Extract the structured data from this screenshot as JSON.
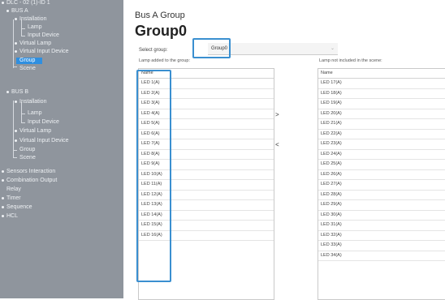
{
  "sidebar": {
    "items": [
      {
        "label": "DLC - 02 (1)-ID 1",
        "selected": false
      },
      {
        "label": "BUS A",
        "selected": false
      },
      {
        "label": "Installation",
        "selected": false
      },
      {
        "label": "Lamp",
        "selected": false
      },
      {
        "label": "Input Device",
        "selected": false
      },
      {
        "label": "Virtual Lamp",
        "selected": false
      },
      {
        "label": "Virtual Input Device",
        "selected": false
      },
      {
        "label": "Group",
        "selected": true
      },
      {
        "label": "Scene",
        "selected": false
      },
      {
        "label": "BUS B",
        "selected": false
      },
      {
        "label": "Installation",
        "selected": false
      },
      {
        "label": "Lamp",
        "selected": false
      },
      {
        "label": "Input Device",
        "selected": false
      },
      {
        "label": "Virtual Lamp",
        "selected": false
      },
      {
        "label": "Virtual Input Device",
        "selected": false
      },
      {
        "label": "Group",
        "selected": false
      },
      {
        "label": "Scene",
        "selected": false
      },
      {
        "label": "Sensors Interaction",
        "selected": false
      },
      {
        "label": "Combination Output",
        "selected": false
      },
      {
        "label": "Relay",
        "selected": false
      },
      {
        "label": "Timer",
        "selected": false
      },
      {
        "label": "Sequence",
        "selected": false
      },
      {
        "label": "HCL",
        "selected": false
      }
    ]
  },
  "main": {
    "subtitle": "Bus A Group",
    "title": "Group0",
    "select_label": "Select group:",
    "select_value": "Group0",
    "select_arrow": "⌄",
    "left_list_label": "Lamp added to the group:",
    "right_list_label": "Lamp not included in the scene:",
    "add_button": ">",
    "remove_button": "<",
    "left_list": {
      "header": "Name",
      "rows": [
        "LED 1(A)",
        "LED 2(A)",
        "LED 3(A)",
        "LED 4(A)",
        "LED 5(A)",
        "LED 6(A)",
        "LED 7(A)",
        "LED 8(A)",
        "LED 9(A)",
        "LED 10(A)",
        "LED 11(A)",
        "LED 12(A)",
        "LED 13(A)",
        "LED 14(A)",
        "LED 15(A)",
        "LED 16(A)"
      ]
    },
    "right_list": {
      "header": "Name",
      "rows": [
        "LED 17(A)",
        "LED 18(A)",
        "LED 19(A)",
        "LED 20(A)",
        "LED 21(A)",
        "LED 22(A)",
        "LED 23(A)",
        "LED 24(A)",
        "LED 25(A)",
        "LED 26(A)",
        "LED 27(A)",
        "LED 28(A)",
        "LED 29(A)",
        "LED 30(A)",
        "LED 31(A)",
        "LED 32(A)",
        "LED 33(A)",
        "LED 34(A)"
      ]
    }
  },
  "colors": {
    "sidebar_bg": "#8f959d",
    "selected_bg": "#2f8fe0",
    "highlight_border": "#3a8fd0"
  }
}
